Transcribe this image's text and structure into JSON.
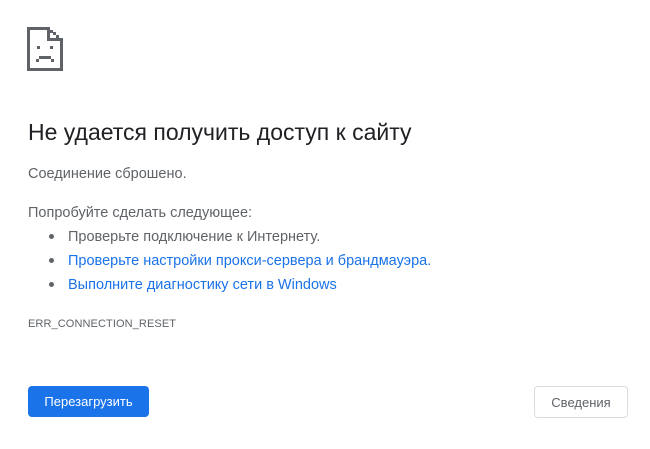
{
  "error": {
    "icon": "sad-page-icon",
    "title": "Не удается получить доступ к сайту",
    "message": "Соединение сброшено.",
    "suggestions_heading": "Попробуйте сделать следующее:",
    "suggestions": [
      {
        "text": "Проверьте подключение к Интернету.",
        "is_link": false
      },
      {
        "text": "Проверьте настройки прокси-сервера и брандмауэра.",
        "is_link": true
      },
      {
        "text": "Выполните диагностику сети в Windows",
        "is_link": true
      }
    ],
    "code": "ERR_CONNECTION_RESET"
  },
  "buttons": {
    "reload_label": "Перезагрузить",
    "details_label": "Сведения"
  },
  "colors": {
    "accent": "#1a73e8",
    "text_primary": "#202124",
    "text_secondary": "#5f6368",
    "border": "#dadce0"
  }
}
